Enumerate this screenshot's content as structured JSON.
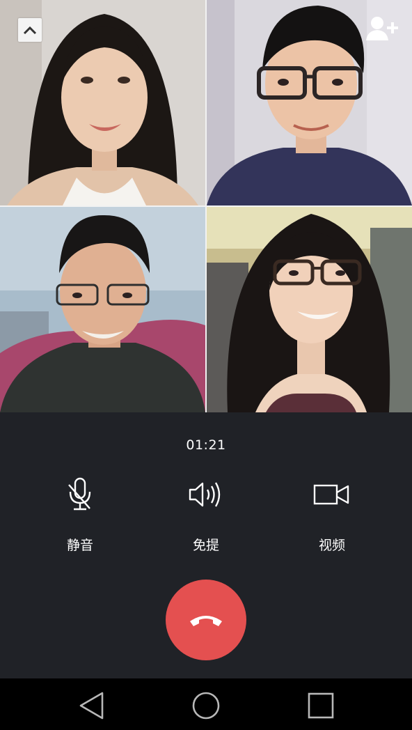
{
  "participants": [
    {
      "name": "participant-1",
      "shirt": "#f4f2ee",
      "bg": "#d8d4d0"
    },
    {
      "name": "participant-2",
      "shirt": "#33345a",
      "bg": "#d8d6dc"
    },
    {
      "name": "participant-3",
      "shirt": "#2f3331",
      "bg": "#9fb3c4"
    },
    {
      "name": "participant-4",
      "shirt": "#3a2a2c",
      "bg": "#c9bf92"
    }
  ],
  "top_controls": {
    "collapse_icon": "chevron-up-icon",
    "add_member_icon": "add-user-icon"
  },
  "call": {
    "timer": "01:21",
    "controls": [
      {
        "id": "mute",
        "label": "静音",
        "icon": "mic-off-icon"
      },
      {
        "id": "speaker",
        "label": "免提",
        "icon": "speaker-icon"
      },
      {
        "id": "video",
        "label": "视频",
        "icon": "video-camera-icon"
      }
    ],
    "hangup_icon": "phone-hangup-icon",
    "hangup_color": "#e45050"
  },
  "navbar": {
    "back_icon": "triangle-back-icon",
    "home_icon": "circle-home-icon",
    "recent_icon": "square-recent-icon"
  }
}
